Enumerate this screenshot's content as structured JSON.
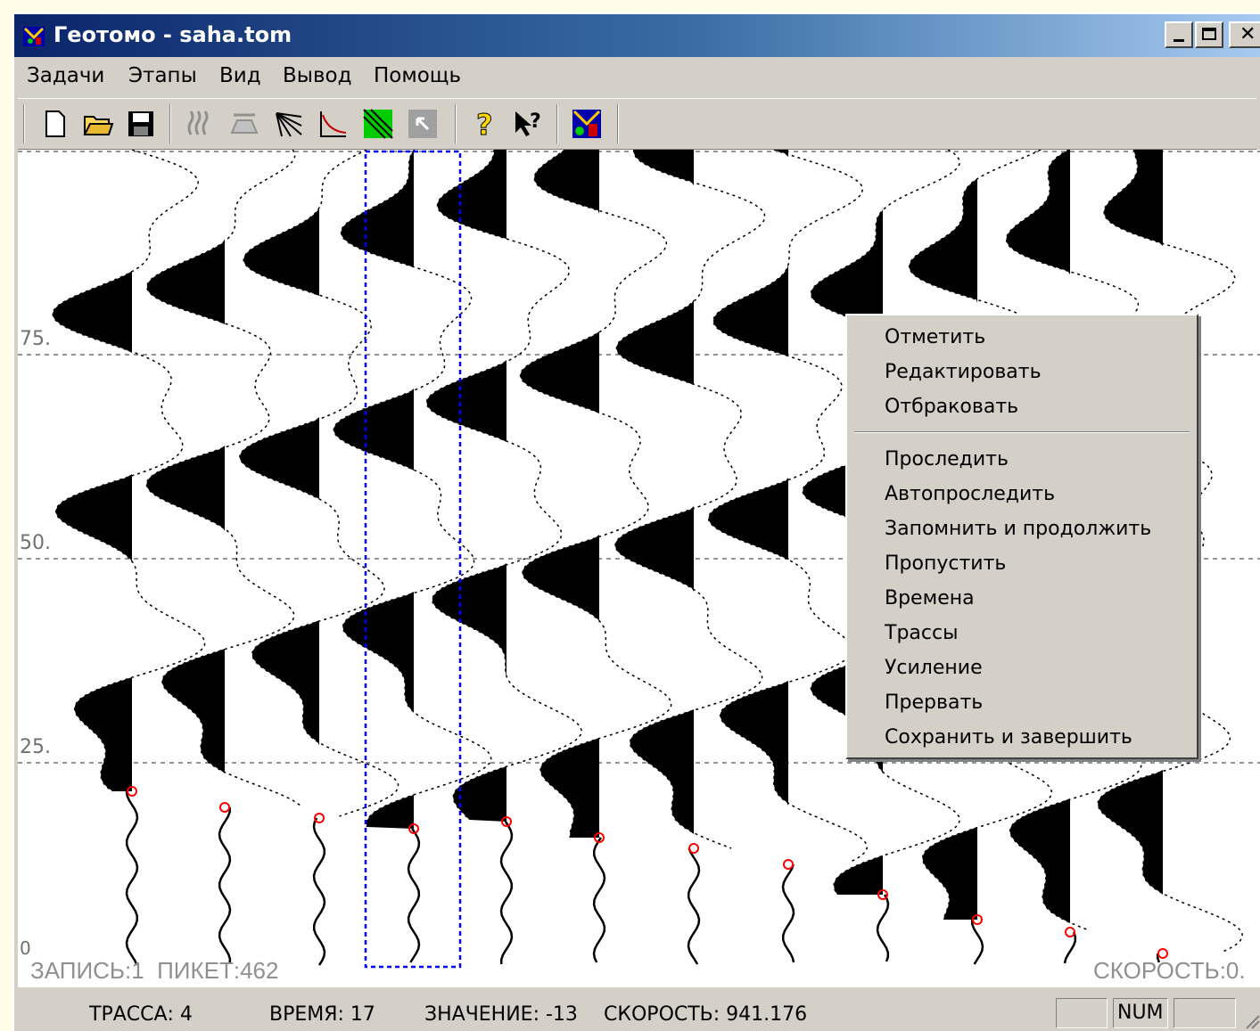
{
  "window": {
    "title": "Геотомо - saha.tom"
  },
  "menu": [
    "Задачи",
    "Этапы",
    "Вид",
    "Вывод",
    "Помощь"
  ],
  "toolbar_icons": [
    "new-file-icon",
    "open-folder-icon",
    "save-icon",
    "seismogram-icon",
    "surface-icon",
    "rays-icon",
    "hodograph-icon",
    "tomography-icon",
    "cursor-box-icon",
    "help-icon",
    "context-help-icon",
    "app-logo-icon"
  ],
  "plot": {
    "axis_labels": [
      "75.",
      "50.",
      "25.",
      "0"
    ],
    "overlay_left": "ЗАПИСЬ:1  ПИКЕТ:462",
    "overlay_right": "СКОРОСТЬ:0."
  },
  "context_menu": {
    "group1": [
      "Отметить",
      "Редактировать",
      "Отбраковать"
    ],
    "group2": [
      "Проследить",
      "Автопроследить",
      "Запомнить и продолжить",
      "Пропустить",
      "Времена",
      "Трассы",
      "Усиление",
      "Прервать",
      "Сохранить и завершить"
    ]
  },
  "status": {
    "trace": "ТРАССА: 4",
    "time": "ВРЕМЯ: 17",
    "value": "ЗНАЧЕНИЕ: -13",
    "speed": "СКОРОСТЬ: 941.176",
    "num": "NUM"
  },
  "colors": {
    "titlebar_start": "#0a246a",
    "pick_marker": "#ff0000",
    "selection": "#0000ff"
  }
}
